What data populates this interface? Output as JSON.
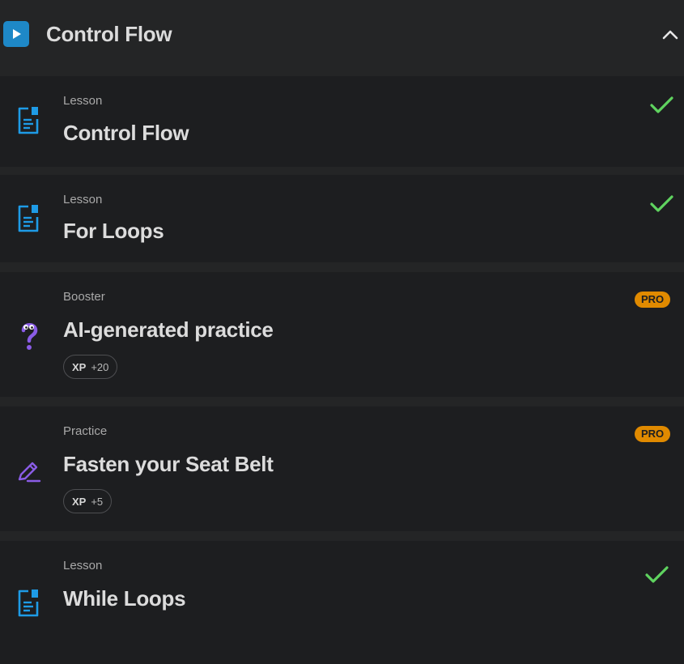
{
  "module": {
    "title": "Control Flow",
    "icon": "play-icon",
    "collapse_icon": "chevron-up-icon"
  },
  "items": [
    {
      "type": "Lesson",
      "title": "Control Flow",
      "icon": "lesson-document-icon",
      "status": "completed"
    },
    {
      "type": "Lesson",
      "title": "For Loops",
      "icon": "lesson-document-icon",
      "status": "completed"
    },
    {
      "type": "Booster",
      "title": "AI-generated practice",
      "icon": "question-icon",
      "badge": "PRO",
      "xp_label": "XP",
      "xp_value": "+20"
    },
    {
      "type": "Practice",
      "title": "Fasten your Seat Belt",
      "icon": "pencil-icon",
      "badge": "PRO",
      "xp_label": "XP",
      "xp_value": "+5"
    },
    {
      "type": "Lesson",
      "title": "While Loops",
      "icon": "lesson-document-icon",
      "status": "completed"
    }
  ],
  "colors": {
    "lesson_icon": "#1e9be6",
    "booster_icon": "#8a5ce6",
    "check": "#5fd35f",
    "pro_badge": "#e08a00"
  }
}
